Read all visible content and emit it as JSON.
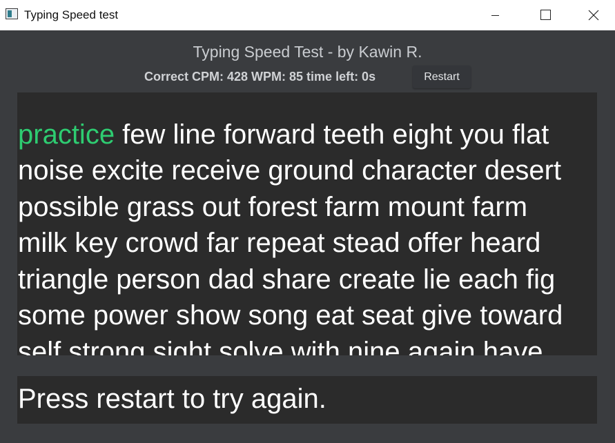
{
  "window": {
    "title": "Typing Speed test"
  },
  "header": {
    "title": "Typing Speed Test - by Kawin R."
  },
  "stats": {
    "text": "Correct CPM: 428 WPM: 85 time left: 0s",
    "cpm": 428,
    "wpm": 85,
    "time_left_s": 0
  },
  "toolbar": {
    "restart_label": "Restart"
  },
  "words": {
    "lines": [
      {
        "typed": "practice",
        "rest": " few line forward teeth eight you flat"
      },
      {
        "typed": "",
        "rest": "noise excite receive ground character desert"
      },
      {
        "typed": "",
        "rest": "possible grass out forest farm mount farm"
      },
      {
        "typed": "",
        "rest": "milk key crowd far repeat stead offer heard"
      },
      {
        "typed": "",
        "rest": "triangle person dad share create lie each fig"
      },
      {
        "typed": "",
        "rest": "some power show song eat seat give toward"
      },
      {
        "typed": "",
        "rest": "self strong sight solve with nine again have"
      }
    ]
  },
  "input": {
    "value": "Press restart to try again."
  },
  "colors": {
    "background": "#3a3c3f",
    "panel": "#2b2b2b",
    "typed_word": "#2ecc71",
    "text": "#ffffff"
  }
}
